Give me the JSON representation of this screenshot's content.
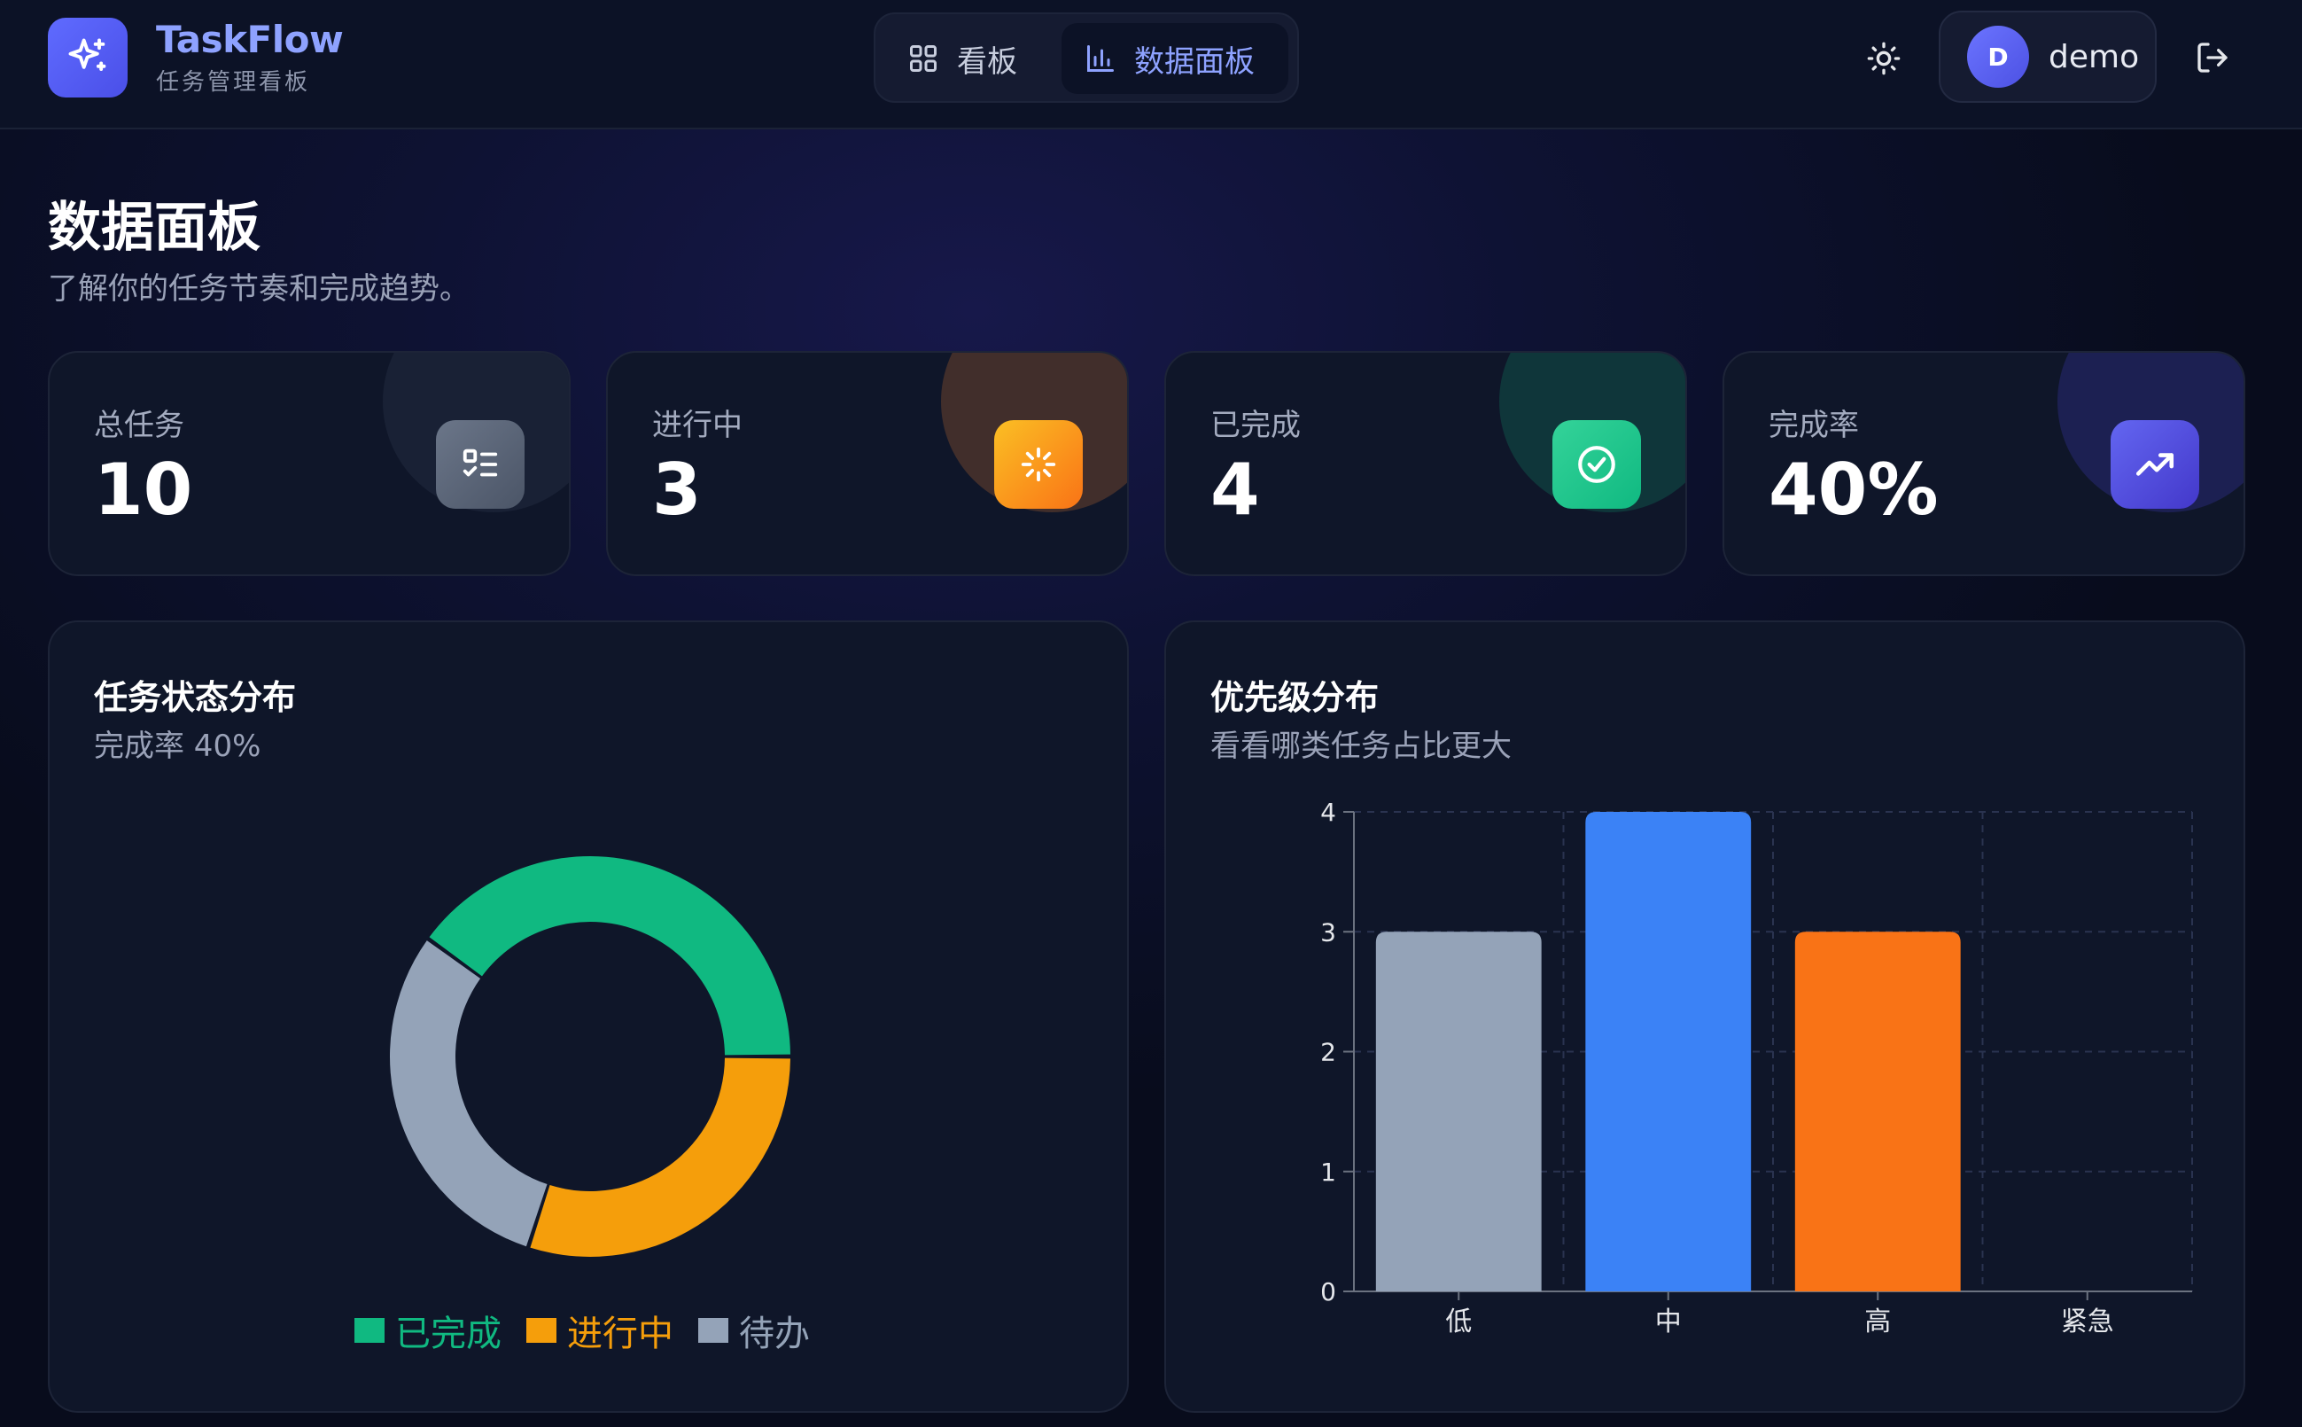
{
  "app": {
    "name": "TaskFlow",
    "subtitle": "任务管理看板"
  },
  "nav": {
    "tabs": [
      {
        "label": "看板",
        "icon": "grid-icon",
        "active": false
      },
      {
        "label": "数据面板",
        "icon": "bar-chart-icon",
        "active": true
      }
    ]
  },
  "user": {
    "avatar_initial": "D",
    "name": "demo"
  },
  "page": {
    "title": "数据面板",
    "subtitle": "了解你的任务节奏和完成趋势。"
  },
  "stats": [
    {
      "label": "总任务",
      "value": "10",
      "icon": "checklist-icon",
      "accent": "#64748b"
    },
    {
      "label": "进行中",
      "value": "3",
      "icon": "loader-icon",
      "accent": "#f59e0b"
    },
    {
      "label": "已完成",
      "value": "4",
      "icon": "check-circle-icon",
      "accent": "#10b981"
    },
    {
      "label": "完成率",
      "value": "40%",
      "icon": "trending-up-icon",
      "accent": "#4f46e5"
    }
  ],
  "status_panel": {
    "title": "任务状态分布",
    "subtitle": "完成率 40%"
  },
  "priority_panel": {
    "title": "优先级分布",
    "subtitle": "看看哪类任务占比更大"
  },
  "chart_data": [
    {
      "type": "pie",
      "variant": "donut",
      "labels": [
        "已完成",
        "进行中",
        "待办"
      ],
      "values": [
        4,
        3,
        3
      ],
      "colors": [
        "#10b981",
        "#f59e0b",
        "#94a3b8"
      ],
      "legend": "bottom"
    },
    {
      "type": "bar",
      "categories": [
        "低",
        "中",
        "高",
        "紧急"
      ],
      "values": [
        3,
        4,
        3,
        0
      ],
      "colors": [
        "#94a3b8",
        "#3b82f6",
        "#f97316",
        "#ef4444"
      ],
      "ylim": [
        0,
        4
      ],
      "yticks": [
        "0",
        "1",
        "2",
        "3",
        "4"
      ],
      "grid": true
    }
  ]
}
